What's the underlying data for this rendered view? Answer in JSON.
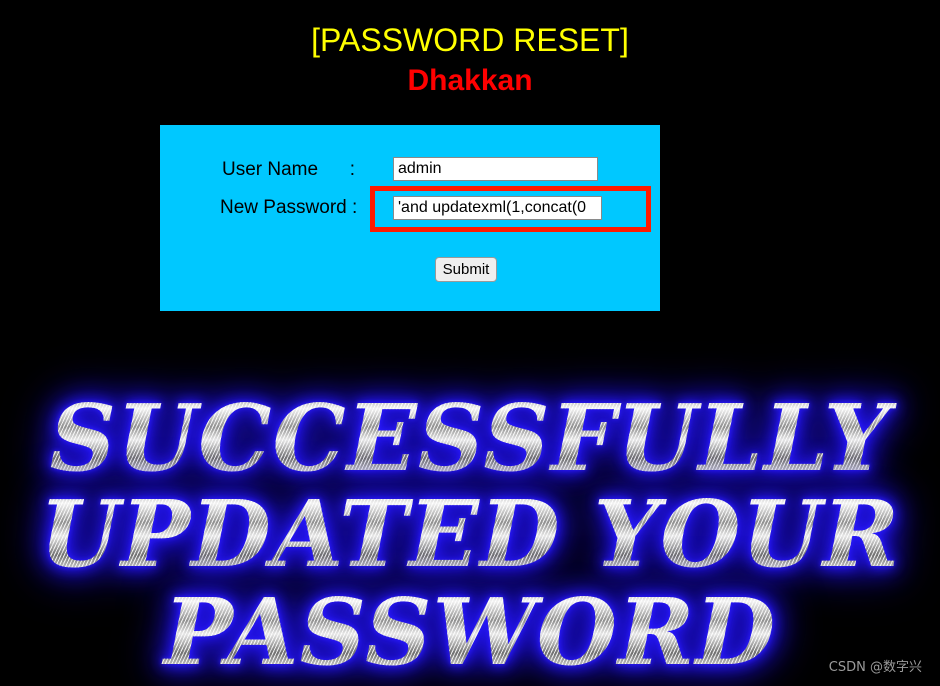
{
  "page": {
    "title": "[PASSWORD RESET]",
    "subtitle": "Dhakkan",
    "background_color": "#000000",
    "title_color": "#ffff00",
    "subtitle_color": "#ff0000"
  },
  "form": {
    "panel_color": "#00c8ff",
    "username": {
      "label": "User Name      :",
      "value": "admin",
      "placeholder": ""
    },
    "password": {
      "label": "New Password :",
      "value": "'and updatexml(1,concat(0",
      "placeholder": ""
    },
    "submit_label": "Submit"
  },
  "annotation": {
    "name": "red-highlight-rectangle",
    "color": "#ff1a00",
    "target": "password-input"
  },
  "success_banner": {
    "line1": "SUCCESSFULLY",
    "line2": "UPDATED YOUR",
    "line3": "PASSWORD",
    "glow_color": "#2a1aff",
    "metal_color": "#b9b9b9"
  },
  "watermark": {
    "text": "CSDN @数字兴"
  }
}
